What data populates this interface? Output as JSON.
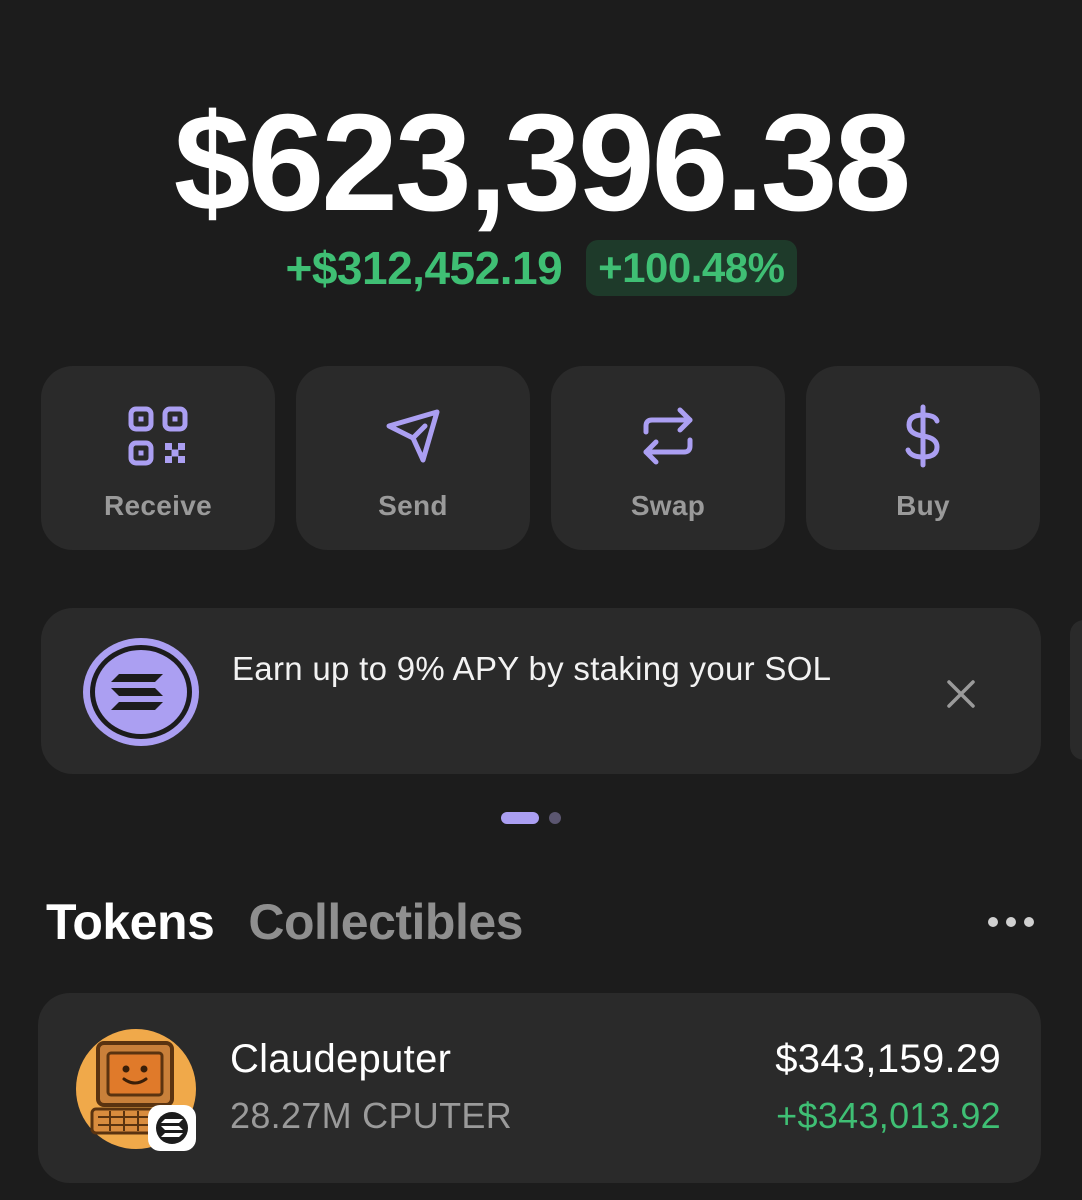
{
  "wallet": {
    "balance": "$623,396.38",
    "change_amount": "+$312,452.19",
    "change_percent": "+100.48%"
  },
  "actions": [
    {
      "label": "Receive",
      "icon": "qr-code-icon"
    },
    {
      "label": "Send",
      "icon": "send-icon"
    },
    {
      "label": "Swap",
      "icon": "swap-icon"
    },
    {
      "label": "Buy",
      "icon": "dollar-icon"
    }
  ],
  "banner": {
    "text": "Earn up to 9% APY by staking your SOL",
    "icon": "solana-logo-icon",
    "close_icon": "close-icon"
  },
  "carousel": {
    "page_count": 2,
    "active_index": 0
  },
  "tabs": [
    {
      "label": "Tokens",
      "active": true
    },
    {
      "label": "Collectibles",
      "active": false
    }
  ],
  "tokens": [
    {
      "name": "Claudeputer",
      "amount": "28.27M CPUTER",
      "value": "$343,159.29",
      "change": "+$343,013.92",
      "icon": "claudeputer-token-avatar"
    }
  ],
  "colors": {
    "background": "#1c1c1c",
    "card": "#2a2a2a",
    "accent": "#ab9ff2",
    "positive": "#3fbf74"
  }
}
